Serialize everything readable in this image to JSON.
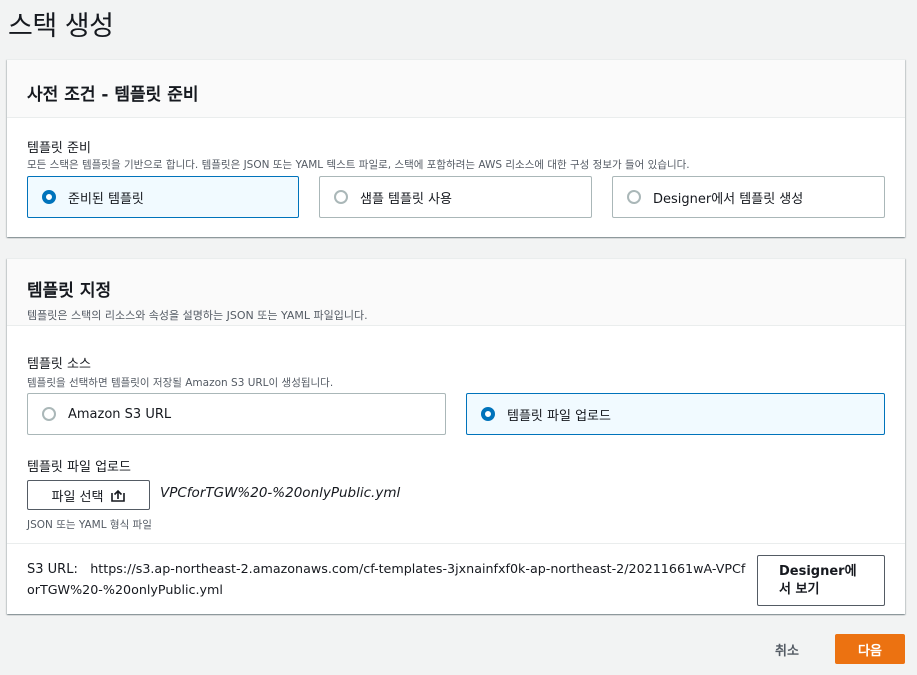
{
  "page": {
    "title": "스택 생성"
  },
  "prereq": {
    "title": "사전 조건 - 템플릿 준비",
    "field_label": "템플릿 준비",
    "field_desc": "모든 스택은 템플릿을 기반으로 합니다. 템플릿은 JSON 또는 YAML 텍스트 파일로, 스택에 포함하려는 AWS 리소스에 대한 구성 정보가 들어 있습니다.",
    "options": [
      {
        "label": "준비된 템플릿",
        "selected": true
      },
      {
        "label": "샘플 템플릿 사용",
        "selected": false
      },
      {
        "label": "Designer에서 템플릿 생성",
        "selected": false
      }
    ]
  },
  "spec": {
    "title": "템플릿 지정",
    "desc": "템플릿은 스택의 리소스와 속성을 설명하는 JSON 또는 YAML 파일입니다.",
    "source_label": "템플릿 소스",
    "source_desc": "템플릿을 선택하면 템플릿이 저장될 Amazon S3 URL이 생성됩니다.",
    "source_options": [
      {
        "label": "Amazon S3 URL",
        "selected": false
      },
      {
        "label": "템플릿 파일 업로드",
        "selected": true
      }
    ],
    "upload_label": "템플릿 파일 업로드",
    "choose_file_label": "파일 선택",
    "file_name": "VPCforTGW%20-%20onlyPublic.yml",
    "file_hint": "JSON 또는 YAML 형식 파일",
    "s3_label": "S3 URL:",
    "s3_url_line1": "https://s3.ap-northeast-2.amazonaws.com/cf-templates-3jxnainfxf0k-ap-northeast-2/20211661wA-VPCf",
    "s3_url_line2": "orTGW%20-%20onlyPublic.yml",
    "designer_line1": "Designer에",
    "designer_line2": "서 보기"
  },
  "footer": {
    "cancel_label": "취소",
    "next_label": "다음"
  },
  "colors": {
    "accent": "#0073bb",
    "primary_button": "#ec7211"
  }
}
